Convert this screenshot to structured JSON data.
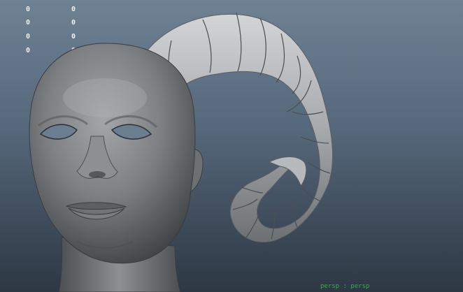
{
  "hud": {
    "column_left": [
      "0",
      "0",
      "0",
      "0"
    ],
    "column_right": [
      "0",
      "0",
      "0",
      "0"
    ]
  },
  "camera_label": "persp : persp",
  "colors": {
    "background_top": "#6e8294",
    "background_bottom": "#2e3844",
    "model_shading": "#8a8d90",
    "hud_text": "#f2f2f2",
    "camera_label": "#2fae4a"
  },
  "icons": [
    "head-model",
    "horn-model"
  ]
}
